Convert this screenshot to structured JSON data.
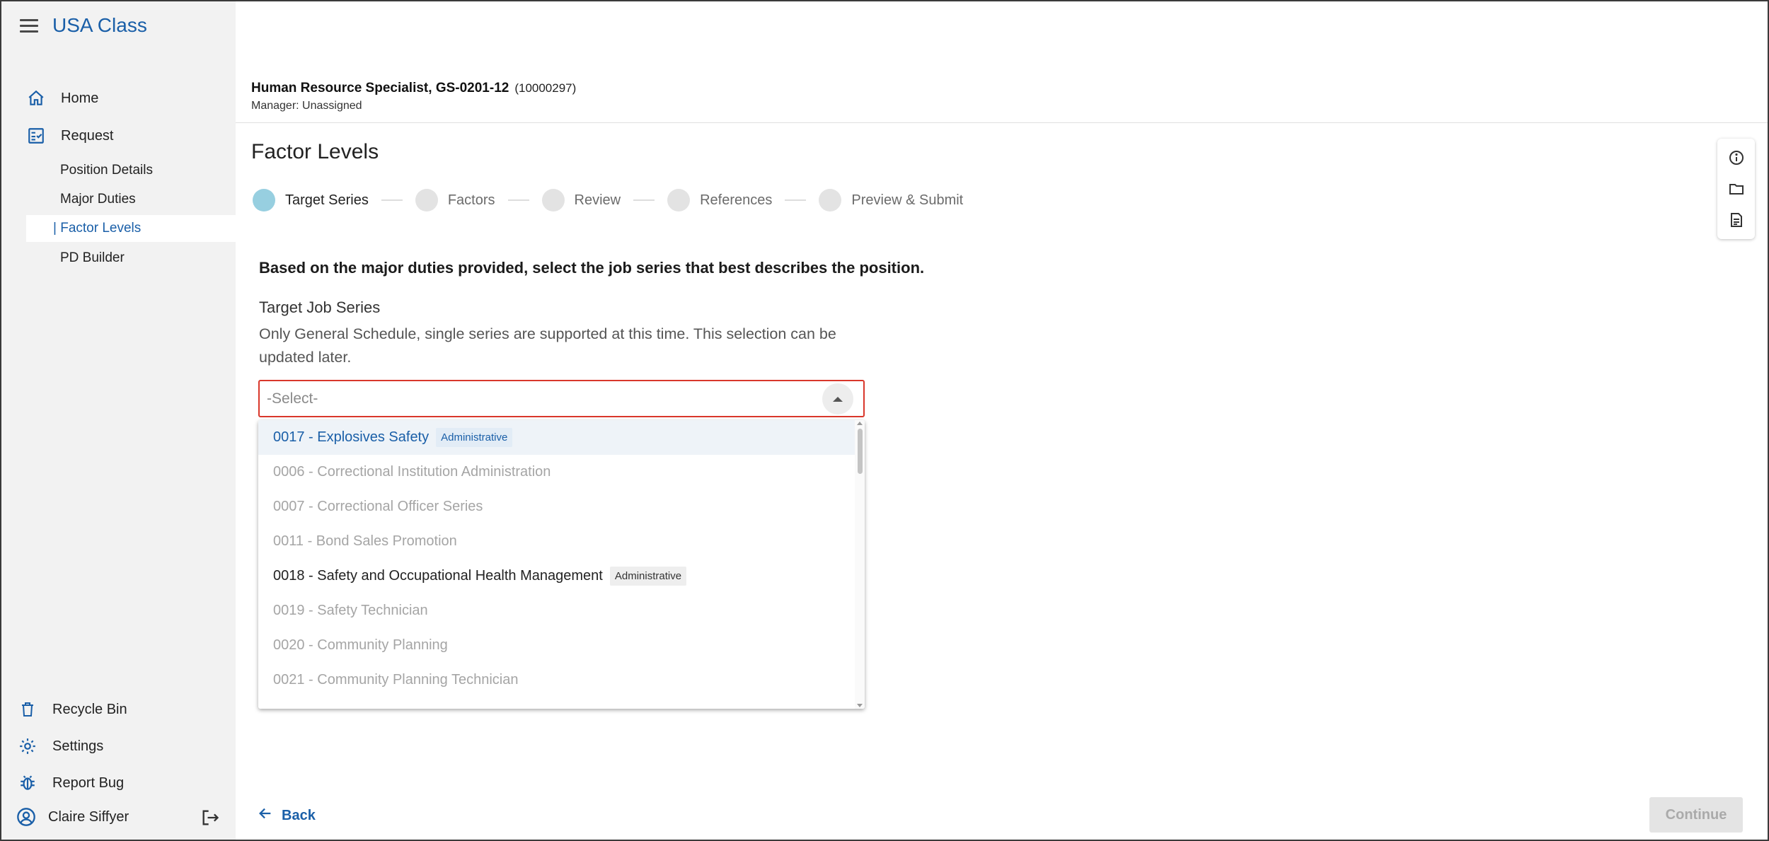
{
  "app": {
    "title": "USA Class"
  },
  "sidebar": {
    "nav": [
      {
        "label": "Home",
        "icon": "home-icon"
      },
      {
        "label": "Request",
        "icon": "request-icon"
      }
    ],
    "sub_items": [
      {
        "label": "Position Details"
      },
      {
        "label": "Major Duties"
      },
      {
        "label": "| Factor Levels",
        "active": true
      },
      {
        "label": "PD Builder"
      }
    ],
    "bottom": [
      {
        "label": "Recycle Bin",
        "icon": "trash-icon"
      },
      {
        "label": "Settings",
        "icon": "gear-icon"
      },
      {
        "label": "Report Bug",
        "icon": "bug-icon"
      }
    ],
    "user": {
      "name": "Claire Siffyer",
      "icon": "user-avatar-icon",
      "logout_icon": "logout-icon"
    }
  },
  "header": {
    "position_title": "Human Resource Specialist, GS-0201-12",
    "position_id": "(10000297)",
    "manager": "Manager: Unassigned"
  },
  "main": {
    "page_title": "Factor Levels",
    "steps": [
      {
        "label": "Target Series",
        "active": true
      },
      {
        "label": "Factors"
      },
      {
        "label": "Review"
      },
      {
        "label": "References"
      },
      {
        "label": "Preview & Submit"
      }
    ],
    "instruction": "Based on the major duties provided, select the job series that best describes the position.",
    "field_label": "Target Job Series",
    "field_help": "Only General Schedule, single series are supported at this time. This selection can be updated later.",
    "select": {
      "placeholder": "-Select-",
      "options": [
        {
          "label": "0017 - Explosives Safety",
          "badge": "Administrative",
          "state": "highlight"
        },
        {
          "label": "0006 - Correctional Institution Administration",
          "badge": "",
          "state": "disabled"
        },
        {
          "label": "0007 - Correctional Officer Series",
          "badge": "",
          "state": "disabled"
        },
        {
          "label": "0011 - Bond Sales Promotion",
          "badge": "",
          "state": "disabled"
        },
        {
          "label": "0018 - Safety and Occupational Health Management",
          "badge": "Administrative",
          "state": "enabled"
        },
        {
          "label": "0019 - Safety Technician",
          "badge": "",
          "state": "disabled"
        },
        {
          "label": "0020 - Community Planning",
          "badge": "",
          "state": "disabled"
        },
        {
          "label": "0021 - Community Planning Technician",
          "badge": "",
          "state": "disabled"
        }
      ]
    },
    "back_label": "Back",
    "continue_label": "Continue"
  },
  "right_panel": {
    "icons": [
      "info-icon",
      "folder-icon",
      "document-icon"
    ]
  },
  "colors": {
    "accent": "#1a5fa8",
    "error": "#d9372b",
    "active_step": "#97cfe0"
  }
}
